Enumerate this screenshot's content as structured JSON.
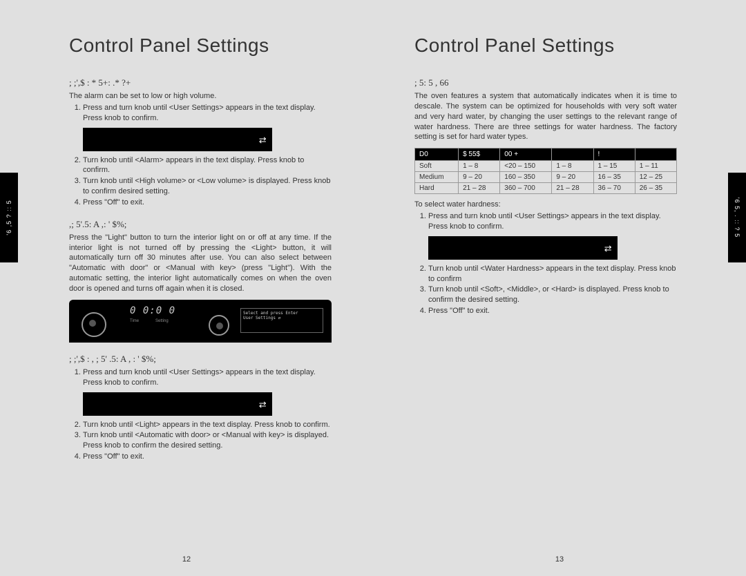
{
  "left": {
    "title": "Control Panel Settings",
    "side_tab": "'6   ,5 ? :: 5",
    "section1": {
      "heading": "; ;',$ : * 5+: .* ?+",
      "intro": "The alarm can be set to low or high volume.",
      "steps": [
        "Press and turn knob until <User Settings> appears in the text display. Press knob to confirm.",
        "Turn knob until <Alarm> appears in the text display. Press knob to confirm.",
        "Turn knob until <High volume> or <Low volume> is displayed. Press knob to confirm desired setting.",
        "Press \"Off\" to exit."
      ]
    },
    "section2": {
      "heading": ",; 5'.5: A    ,: ' $%;",
      "body": "Press the \"Light\" button to turn the interior light on or off at any time. If the interior light is not turned off by pressing the <Light> button, it will automatically turn off 30 minutes after use. You can also select between \"Automatic with door\" or <Manual with key> (press \"Light\"). With the automatic setting, the interior light automatically comes on when the oven door is opened and turns off again when it is closed."
    },
    "panel": {
      "time": "0 0:0 0",
      "display_line1": "Select and press Enter",
      "display_line2": "User Settings         ⇄",
      "label_time": "Time",
      "label_setting": "Setting"
    },
    "section3": {
      "heading": "; ;',$ : , ; 5' .5: A    , : ' $%;",
      "steps": [
        "Press and turn knob until <User Settings> appears in the text display. Press knob to confirm.",
        "Turn knob until <Light> appears in the text display. Press knob to confirm.",
        "Turn knob until <Automatic with door> or <Manual with key> is displayed. Press knob to confirm the desired setting.",
        "Press \"Off\" to exit."
      ]
    },
    "page_num": "12"
  },
  "right": {
    "title": "Control Panel Settings",
    "side_tab": "'6 5, . :: ? 5",
    "section1": {
      "heading": "; 5:   5 , 66",
      "intro": "The oven features a system that automatically indicates when it is time to descale. The system can be optimized for households with very soft water and very hard water, by changing the user settings to the relevant range of water hardness. There are three settings for water hardness. The factory setting is set for hard water types."
    },
    "table": {
      "headers": [
        "D0",
        "$ 55$",
        "00 +",
        "",
        "!",
        ""
      ],
      "rows": [
        [
          "Soft",
          "1 – 8",
          "<20 – 150",
          "1 – 8",
          "1 – 15",
          "1 – 11"
        ],
        [
          "Medium",
          "9 – 20",
          "160 – 350",
          "9 – 20",
          "16 – 35",
          "12 – 25"
        ],
        [
          "Hard",
          "21 – 28",
          "360 – 700",
          "21 – 28",
          "36 – 70",
          "26 – 35"
        ]
      ]
    },
    "section2": {
      "intro": "To select water hardness:",
      "steps": [
        "Press and turn knob until <User Settings> appears in the text display. Press knob to confirm.",
        "Turn knob until <Water Hardness> appears in the text display. Press knob to confirm",
        "Turn knob until <Soft>, <Middle>, or <Hard> is displayed. Press knob to confirm the desired setting.",
        "Press \"Off\" to exit."
      ]
    },
    "page_num": "13"
  }
}
